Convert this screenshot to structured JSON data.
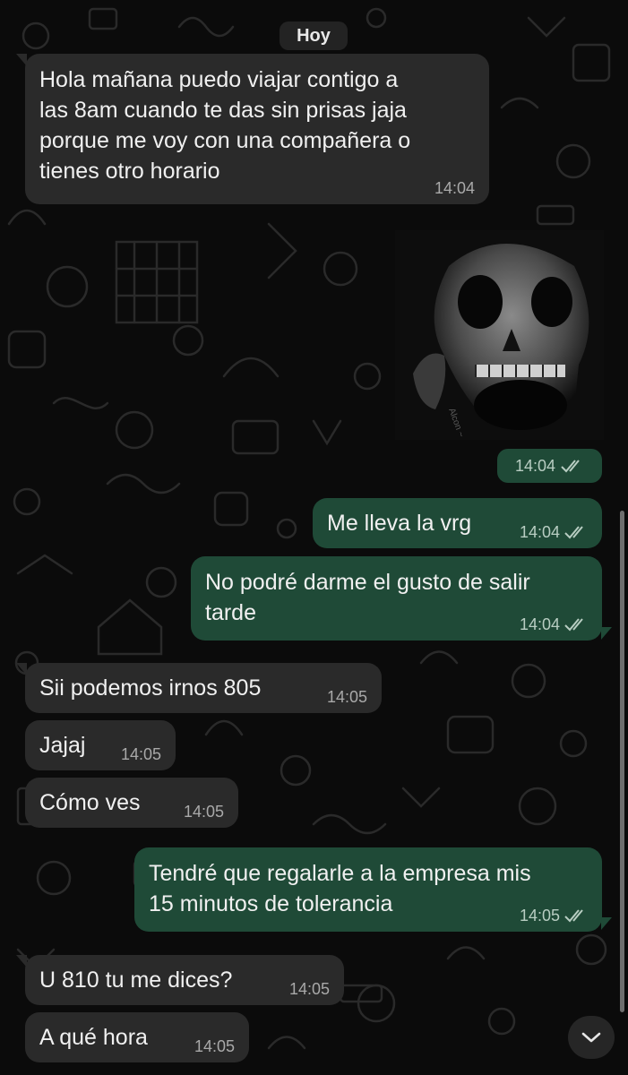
{
  "date_separator": "Hoy",
  "messages": [
    {
      "direction": "in",
      "text_lines": [
        "Hola mañana puedo viajar contigo a",
        "las 8am cuando te das sin prisas jaja",
        "porque me voy con una compañera o",
        "tienes otro horario"
      ],
      "time": "14:04"
    },
    {
      "direction": "out",
      "type": "image",
      "image_subject": "skull-image",
      "watermark": "Alcon ~",
      "time": "14:04",
      "status": "read"
    },
    {
      "direction": "out",
      "text_lines": [
        "Me lleva la vrg"
      ],
      "time": "14:04",
      "status": "read"
    },
    {
      "direction": "out",
      "text_lines": [
        "No podré darme el gusto de salir",
        "tarde"
      ],
      "time": "14:04",
      "status": "read"
    },
    {
      "direction": "in",
      "text_lines": [
        "Sii podemos irnos 805"
      ],
      "time": "14:05"
    },
    {
      "direction": "in",
      "text_lines": [
        "Jajaj"
      ],
      "time": "14:05"
    },
    {
      "direction": "in",
      "text_lines": [
        "Cómo ves"
      ],
      "time": "14:05"
    },
    {
      "direction": "out",
      "text_lines": [
        "Tendré que regalarle a la empresa mis",
        "15 minutos de tolerancia"
      ],
      "time": "14:05",
      "status": "read"
    },
    {
      "direction": "in",
      "text_lines": [
        "U 810 tu me dices?"
      ],
      "time": "14:05"
    },
    {
      "direction": "in",
      "text_lines": [
        "A qué hora"
      ],
      "time": "14:05"
    }
  ],
  "scroll_button_icon": "chevron-down-icon",
  "read_receipt_icon": "double-check-icon",
  "colors": {
    "background": "#0b0b0b",
    "incoming_bubble": "#2a2a2a",
    "outgoing_bubble": "#1f4a37",
    "timestamp": "#a9a9a9"
  }
}
